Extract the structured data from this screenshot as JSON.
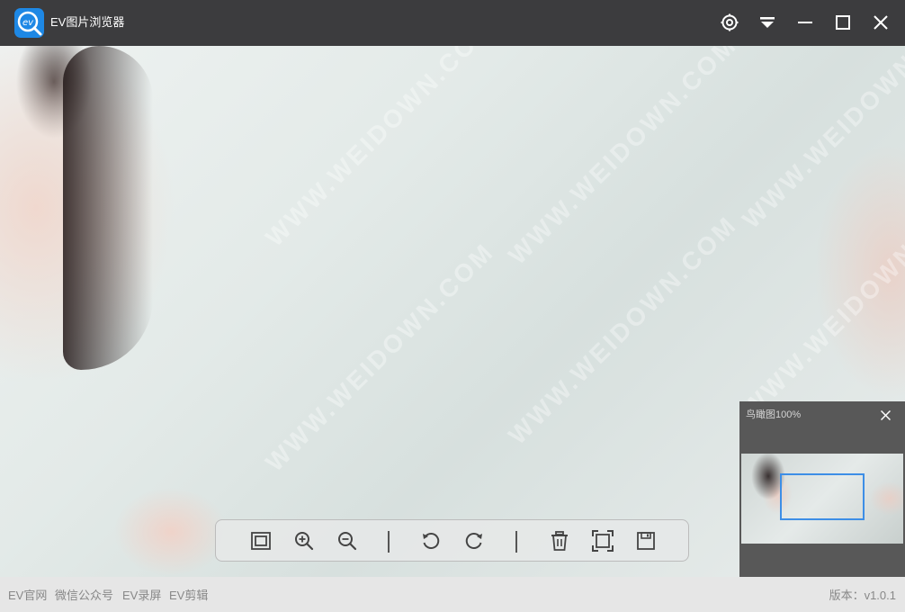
{
  "window": {
    "title": "EV图片浏览器",
    "logo_text": "ev",
    "controls": [
      "settings-icon",
      "dropdown-icon",
      "minimize-icon",
      "maximize-icon",
      "close-icon"
    ]
  },
  "viewer": {
    "watermark_text": "WWW.WEIDOWN.COM"
  },
  "toolbar": {
    "tools": [
      "fit-window-icon",
      "zoom-in-icon",
      "zoom-out-icon",
      "rotate-left-icon",
      "rotate-right-icon",
      "delete-icon",
      "fullscreen-icon",
      "save-icon"
    ]
  },
  "overview": {
    "title": "鸟瞰图100%"
  },
  "footer": {
    "links": [
      "EV官网",
      "微信公众号",
      "EV录屏",
      "EV剪辑"
    ],
    "version": "版本：v1.0.1"
  },
  "colors": {
    "titlebar": "#3c3c3e",
    "accent": "#1e88e5",
    "overview_frame": "#3d8ee6",
    "statusbar": "#e6e6e6"
  }
}
